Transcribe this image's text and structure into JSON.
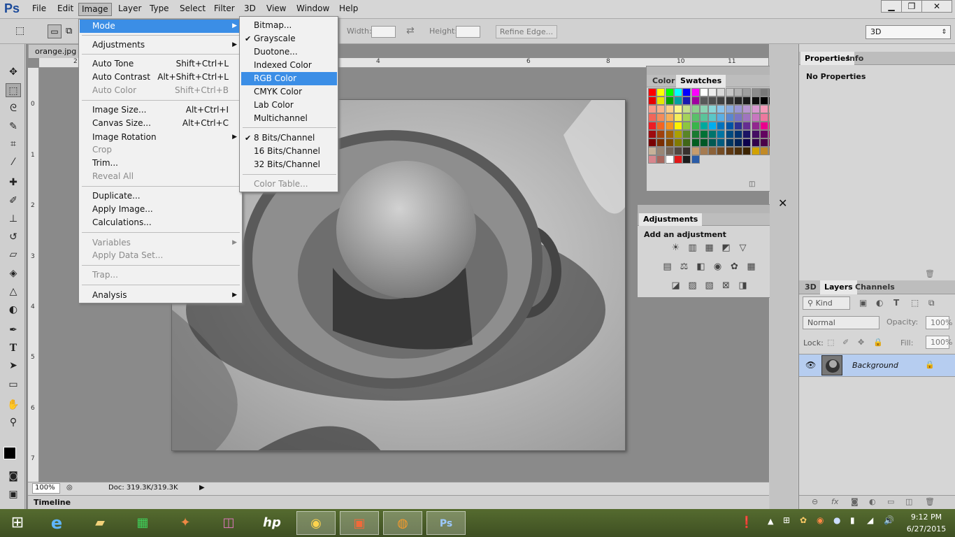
{
  "app": {
    "logo": "Ps"
  },
  "menubar": {
    "items": [
      "File",
      "Edit",
      "Image",
      "Layer",
      "Type",
      "Select",
      "Filter",
      "3D",
      "View",
      "Window",
      "Help"
    ],
    "active": "Image"
  },
  "options": {
    "width_label": "Width:",
    "height_label": "Height:",
    "refine_edge": "Refine Edge...",
    "workspace": "3D"
  },
  "document": {
    "tab": "orange.jpg",
    "zoom": "100%",
    "doc_info": "Doc: 319.3K/319.3K",
    "timeline": "Timeline"
  },
  "ruler": {
    "h": [
      "2",
      "4",
      "6",
      "8",
      "10",
      "11"
    ],
    "v": [
      "0",
      "1",
      "2",
      "3",
      "4",
      "5",
      "6",
      "7"
    ]
  },
  "image_menu": {
    "items": [
      {
        "label": "Mode",
        "shortcut": "",
        "submenu": true,
        "state": "highlighted"
      },
      {
        "label": "Adjustments",
        "shortcut": "",
        "submenu": true
      },
      {
        "label": "Auto Tone",
        "shortcut": "Shift+Ctrl+L"
      },
      {
        "label": "Auto Contrast",
        "shortcut": "Alt+Shift+Ctrl+L"
      },
      {
        "label": "Auto Color",
        "shortcut": "Shift+Ctrl+B",
        "state": "disabled"
      },
      {
        "label": "Image Size...",
        "shortcut": "Alt+Ctrl+I"
      },
      {
        "label": "Canvas Size...",
        "shortcut": "Alt+Ctrl+C"
      },
      {
        "label": "Image Rotation",
        "shortcut": "",
        "submenu": true
      },
      {
        "label": "Crop",
        "shortcut": "",
        "state": "disabled"
      },
      {
        "label": "Trim...",
        "shortcut": ""
      },
      {
        "label": "Reveal All",
        "shortcut": "",
        "state": "disabled"
      },
      {
        "label": "Duplicate...",
        "shortcut": ""
      },
      {
        "label": "Apply Image...",
        "shortcut": ""
      },
      {
        "label": "Calculations...",
        "shortcut": ""
      },
      {
        "label": "Variables",
        "shortcut": "",
        "submenu": true,
        "state": "disabled"
      },
      {
        "label": "Apply Data Set...",
        "shortcut": "",
        "state": "disabled"
      },
      {
        "label": "Trap...",
        "shortcut": "",
        "state": "disabled"
      },
      {
        "label": "Analysis",
        "shortcut": "",
        "submenu": true
      }
    ]
  },
  "mode_menu": {
    "items": [
      {
        "label": "Bitmap...",
        "checked": false
      },
      {
        "label": "Grayscale",
        "checked": true
      },
      {
        "label": "Duotone...",
        "checked": false
      },
      {
        "label": "Indexed Color",
        "checked": false
      },
      {
        "label": "RGB Color",
        "checked": false,
        "state": "highlighted"
      },
      {
        "label": "CMYK Color",
        "checked": false
      },
      {
        "label": "Lab Color",
        "checked": false
      },
      {
        "label": "Multichannel",
        "checked": false
      },
      {
        "label": "8 Bits/Channel",
        "checked": true
      },
      {
        "label": "16 Bits/Channel",
        "checked": false
      },
      {
        "label": "32 Bits/Channel",
        "checked": false
      },
      {
        "label": "Color Table...",
        "checked": false,
        "state": "disabled"
      }
    ]
  },
  "swatches_panel": {
    "tabs": [
      "Color",
      "Swatches"
    ],
    "active": "Swatches"
  },
  "adjustments_panel": {
    "title": "Adjustments",
    "subtitle": "Add an adjustment"
  },
  "properties_panel": {
    "tabs": [
      "Properties",
      "Info"
    ],
    "content": "No Properties"
  },
  "layers_panel": {
    "tabs": [
      "3D",
      "Layers",
      "Channels"
    ],
    "active": "Layers",
    "kind": "Kind",
    "blend": "Normal",
    "opacity_label": "Opacity:",
    "opacity": "100%",
    "lock_label": "Lock:",
    "fill_label": "Fill:",
    "fill": "100%",
    "layer_name": "Background"
  },
  "taskbar": {
    "time": "9:12 PM",
    "date": "6/27/2015"
  },
  "colors": {
    "accent": "#3b8ee6",
    "layer_selected": "#b6cdf0"
  }
}
